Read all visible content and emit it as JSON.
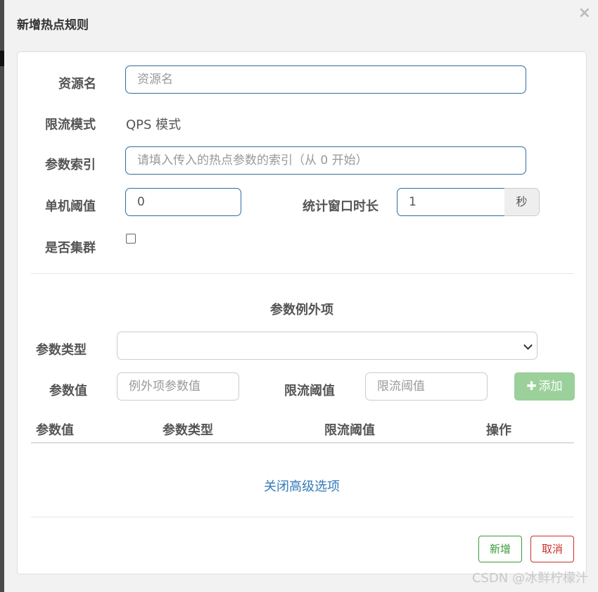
{
  "dialog": {
    "title": "新增热点规则",
    "close_symbol": "×"
  },
  "form": {
    "resource": {
      "label": "资源名",
      "placeholder": "资源名",
      "value": ""
    },
    "mode": {
      "label": "限流模式",
      "value": "QPS 模式"
    },
    "param_index": {
      "label": "参数索引",
      "placeholder": "请填入传入的热点参数的索引（从 0 开始）",
      "value": ""
    },
    "threshold": {
      "label": "单机阈值",
      "value": "0"
    },
    "window": {
      "label": "统计窗口时长",
      "value": "1",
      "unit": "秒"
    },
    "cluster": {
      "label": "是否集群",
      "checked": false
    }
  },
  "exceptions": {
    "title": "参数例外项",
    "param_type": {
      "label": "参数类型",
      "value": ""
    },
    "param_value": {
      "label": "参数值",
      "placeholder": "例外项参数值"
    },
    "limit": {
      "label": "限流阈值",
      "placeholder": "限流阈值"
    },
    "add_button": {
      "icon": "plus-icon",
      "label": "添加"
    },
    "table": {
      "columns": [
        "参数值",
        "参数类型",
        "限流阈值",
        "操作"
      ],
      "rows": []
    }
  },
  "advanced_toggle": "关闭高级选项",
  "footer": {
    "ok_label": "新增",
    "cancel_label": "取消"
  },
  "watermark": "CSDN @冰鲜柠檬汁"
}
